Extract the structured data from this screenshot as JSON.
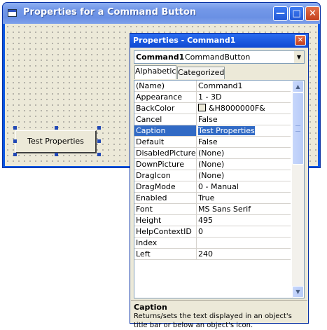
{
  "form_window": {
    "title": "Properties for a Command Button",
    "command_button_label": "Test Properties"
  },
  "properties_window": {
    "title": "Properties - Command1",
    "object_selector": {
      "object": "Command1",
      "type": "CommandButton"
    },
    "tabs": [
      {
        "label": "Alphabetic",
        "active": true
      },
      {
        "label": "Categorized",
        "active": false
      }
    ],
    "rows": [
      {
        "name": "(Name)",
        "value": "Command1"
      },
      {
        "name": "Appearance",
        "value": "1 - 3D"
      },
      {
        "name": "BackColor",
        "value": "&H8000000F&",
        "swatch": true
      },
      {
        "name": "Cancel",
        "value": "False"
      },
      {
        "name": "Caption",
        "value": "Test Properties",
        "selected": true
      },
      {
        "name": "Default",
        "value": "False"
      },
      {
        "name": "DisabledPicture",
        "value": "(None)"
      },
      {
        "name": "DownPicture",
        "value": "(None)"
      },
      {
        "name": "DragIcon",
        "value": "(None)"
      },
      {
        "name": "DragMode",
        "value": "0 - Manual"
      },
      {
        "name": "Enabled",
        "value": "True"
      },
      {
        "name": "Font",
        "value": "MS Sans Serif"
      },
      {
        "name": "Height",
        "value": "495"
      },
      {
        "name": "HelpContextID",
        "value": "0"
      },
      {
        "name": "Index",
        "value": ""
      },
      {
        "name": "Left",
        "value": "240"
      }
    ],
    "description": {
      "title": "Caption",
      "text": "Returns/sets the text displayed in an object's title bar or below an object's icon."
    }
  },
  "colors": {
    "titlebar_blue": "#0a56e2",
    "selection_blue": "#316ac5",
    "dialog_face": "#ece9d8",
    "grid_line": "#d6d3ce"
  },
  "icons": {
    "form_app_icon": "window-icon",
    "minimize": "minimize-icon",
    "maximize": "maximize-icon",
    "close": "close-icon",
    "dropdown": "chevron-down-icon",
    "scroll_up": "chevron-up-icon",
    "scroll_down": "chevron-down-icon"
  }
}
